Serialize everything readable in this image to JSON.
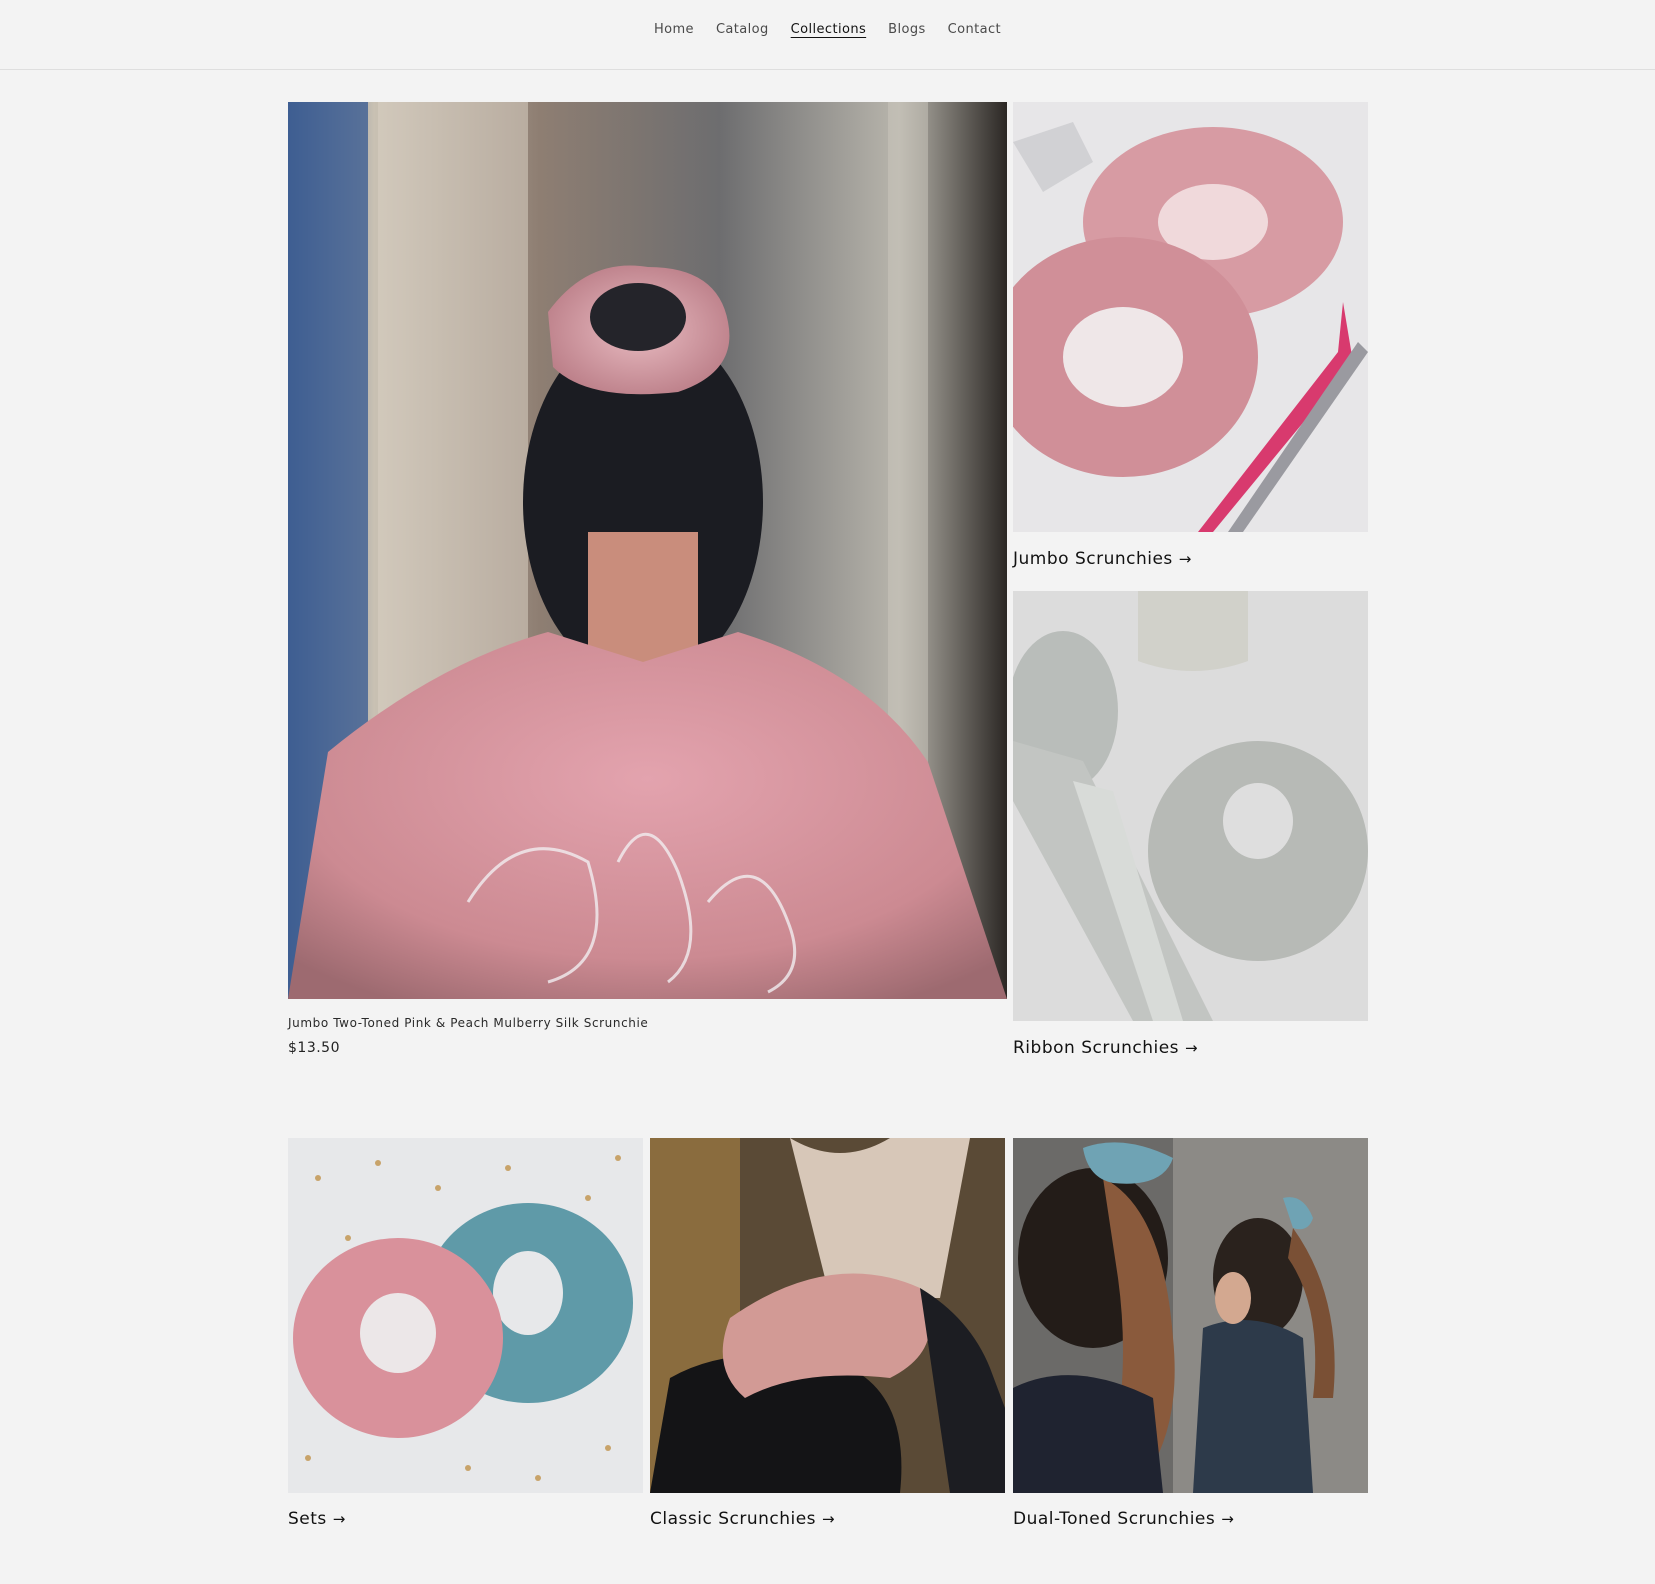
{
  "nav": {
    "items": [
      {
        "label": "Home"
      },
      {
        "label": "Catalog"
      },
      {
        "label": "Collections",
        "active": true
      },
      {
        "label": "Blogs"
      },
      {
        "label": "Contact"
      }
    ]
  },
  "featured": {
    "title": "Jumbo Two-Toned Pink & Peach Mulberry Silk Scrunchie",
    "price": "$13.50"
  },
  "collections": [
    {
      "label": "Jumbo Scrunchies",
      "arrow": "→"
    },
    {
      "label": "Ribbon Scrunchies",
      "arrow": "→"
    },
    {
      "label": "Sets",
      "arrow": "→"
    },
    {
      "label": "Classic Scrunchies",
      "arrow": "→"
    },
    {
      "label": "Dual-Toned Scrunchies",
      "arrow": "→"
    }
  ],
  "colors": {
    "background": "#f3f3f3",
    "text": "#121212",
    "pink_silk": "#d9919b",
    "blue_silk": "#5f9aa8",
    "silver_silk": "#b9bdb9"
  }
}
